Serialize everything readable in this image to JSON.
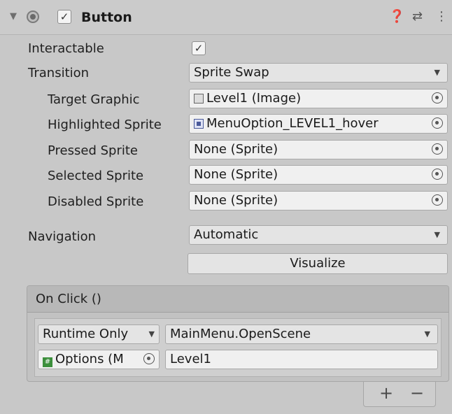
{
  "header": {
    "title": "Button",
    "enabled_check": "✓",
    "expand_icon": "triangle-down-icon",
    "icons": [
      "help-icon",
      "preset-icon",
      "more-icon"
    ]
  },
  "properties": {
    "interactable_label": "Interactable",
    "interactable_check": "✓",
    "transition_label": "Transition",
    "transition_value": "Sprite Swap",
    "target_graphic_label": "Target Graphic",
    "target_graphic_value": "Level1 (Image)",
    "highlighted_sprite_label": "Highlighted Sprite",
    "highlighted_sprite_value": "MenuOption_LEVEL1_hover",
    "pressed_sprite_label": "Pressed Sprite",
    "pressed_sprite_value": "None (Sprite)",
    "selected_sprite_label": "Selected Sprite",
    "selected_sprite_value": "None (Sprite)",
    "disabled_sprite_label": "Disabled Sprite",
    "disabled_sprite_value": "None (Sprite)",
    "navigation_label": "Navigation",
    "navigation_value": "Automatic",
    "visualize_label": "Visualize"
  },
  "on_click": {
    "title": "On Click ()",
    "runtime_value": "Runtime Only",
    "function_value": "MainMenu.OpenScene",
    "object_value": "Options (M",
    "argument_value": "Level1",
    "add_label": "+",
    "remove_label": "−"
  },
  "colors": {
    "background": "#c8c8c8",
    "field": "#f0f0f0",
    "dropdown": "#e4e4e4"
  }
}
